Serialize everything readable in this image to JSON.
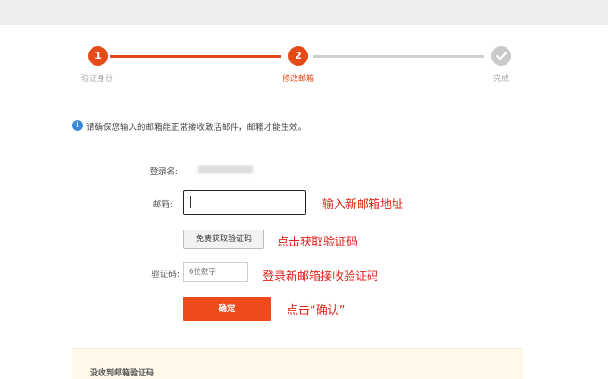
{
  "steps": [
    {
      "number": "1",
      "label": "验证身份",
      "state": "done"
    },
    {
      "number": "2",
      "label": "修改邮箱",
      "state": "current"
    },
    {
      "number": "",
      "label": "完成",
      "state": "pending",
      "icon": "check-icon"
    }
  ],
  "notice": {
    "icon": "info-icon",
    "icon_glyph": "i",
    "text": "请确保您输入的邮箱能正常接收激活邮件，邮箱才能生效。"
  },
  "form": {
    "username_label": "登录名:",
    "email_label": "邮箱:",
    "email_value": "",
    "send_code_label": "免费获取验证码",
    "code_label": "验证码:",
    "code_placeholder": "6位数字",
    "confirm_label": "确定"
  },
  "annotations": {
    "email_hint": "输入新邮箱地址",
    "code_button_hint": "点击获取验证码",
    "code_input_hint": "登录新邮箱接收验证码",
    "confirm_hint": "点击“确认”"
  },
  "bottom_panel": {
    "title": "没收到邮箱验证码"
  },
  "colors": {
    "accent": "#e64a19",
    "annotation": "#e0241b",
    "info": "#3b8ad9"
  }
}
